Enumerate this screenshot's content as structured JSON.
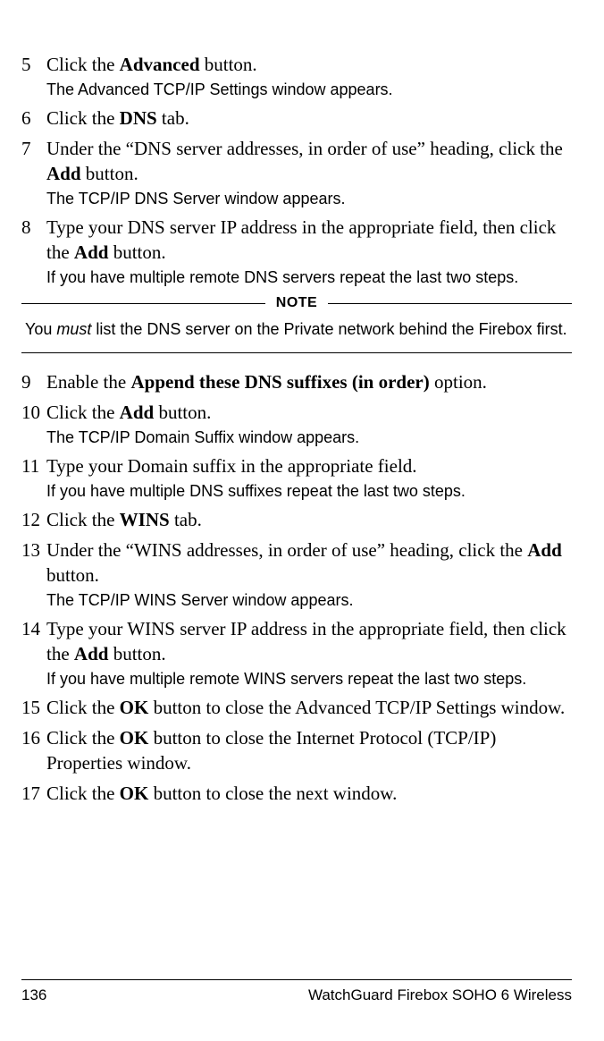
{
  "steps_a": [
    {
      "n": "5",
      "main": [
        {
          "t": "Click the "
        },
        {
          "t": "Advanced",
          "b": true
        },
        {
          "t": " button."
        }
      ],
      "sub": [
        {
          "t": "The Advanced TCP/IP Settings window appears."
        }
      ]
    },
    {
      "n": "6",
      "main": [
        {
          "t": "Click the "
        },
        {
          "t": "DNS",
          "b": true
        },
        {
          "t": " tab."
        }
      ]
    },
    {
      "n": "7",
      "main": [
        {
          "t": "Under the “DNS server addresses, in order of use” heading, click the "
        },
        {
          "t": "Add",
          "b": true
        },
        {
          "t": " button."
        }
      ],
      "sub": [
        {
          "t": "The TCP/IP DNS Server window appears."
        }
      ]
    },
    {
      "n": "8",
      "main": [
        {
          "t": "Type your DNS server IP address in the appropriate field, then click the "
        },
        {
          "t": "Add",
          "b": true
        },
        {
          "t": " button."
        }
      ],
      "sub": [
        {
          "t": "If you have multiple remote DNS servers repeat the last two steps."
        }
      ]
    }
  ],
  "note": {
    "label": "NOTE",
    "body": [
      {
        "t": "You "
      },
      {
        "t": "must",
        "i": true
      },
      {
        "t": " list the DNS server on the Private network behind the Firebox first."
      }
    ]
  },
  "steps_b": [
    {
      "n": "9",
      "main": [
        {
          "t": "Enable the "
        },
        {
          "t": "Append these DNS suffixes (in order)",
          "b": true
        },
        {
          "t": " option."
        }
      ]
    },
    {
      "n": "10",
      "main": [
        {
          "t": "Click the "
        },
        {
          "t": "Add",
          "b": true
        },
        {
          "t": " button."
        }
      ],
      "sub": [
        {
          "t": "The TCP/IP Domain Suffix window appears."
        }
      ]
    },
    {
      "n": "11",
      "main": [
        {
          "t": "Type your Domain suffix in the appropriate field."
        }
      ],
      "sub": [
        {
          "t": "If you have multiple DNS suffixes repeat the last two steps."
        }
      ]
    },
    {
      "n": "12",
      "main": [
        {
          "t": "Click the "
        },
        {
          "t": "WINS",
          "b": true
        },
        {
          "t": " tab."
        }
      ]
    },
    {
      "n": "13",
      "main": [
        {
          "t": "Under the “WINS addresses, in order of use” heading, click the "
        },
        {
          "t": "Add",
          "b": true
        },
        {
          "t": " button."
        }
      ],
      "sub": [
        {
          "t": "The TCP/IP WINS Server window appears."
        }
      ]
    },
    {
      "n": "14",
      "main": [
        {
          "t": "Type your WINS server IP address in the appropriate field, then click the "
        },
        {
          "t": "Add",
          "b": true
        },
        {
          "t": " button."
        }
      ],
      "sub": [
        {
          "t": "If you have multiple remote WINS servers repeat the last two steps."
        }
      ]
    },
    {
      "n": "15",
      "main": [
        {
          "t": "Click the "
        },
        {
          "t": "OK",
          "b": true
        },
        {
          "t": " button to close the Advanced TCP/IP Settings window."
        }
      ]
    },
    {
      "n": "16",
      "main": [
        {
          "t": "Click the "
        },
        {
          "t": "OK",
          "b": true
        },
        {
          "t": " button to close the Internet Protocol (TCP/IP) Properties window."
        }
      ]
    },
    {
      "n": "17",
      "main": [
        {
          "t": "Click the "
        },
        {
          "t": "OK",
          "b": true
        },
        {
          "t": " button to close the next window."
        }
      ]
    }
  ],
  "footer": {
    "page_number": "136",
    "title": "WatchGuard Firebox SOHO 6 Wireless"
  }
}
